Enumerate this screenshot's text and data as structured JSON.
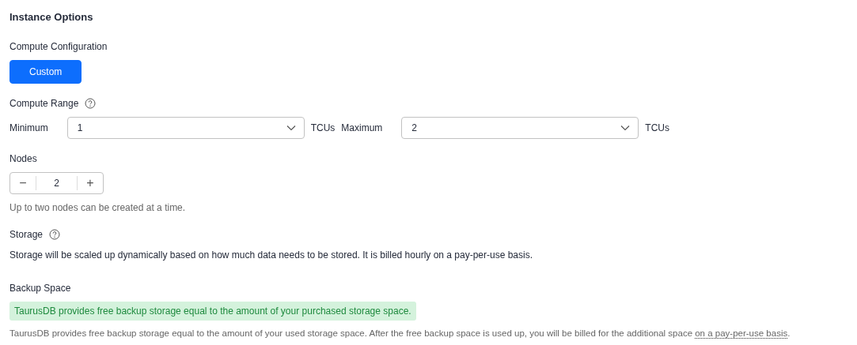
{
  "section_title": "Instance Options",
  "compute_configuration": {
    "label": "Compute Configuration",
    "options": [
      {
        "label": "Custom",
        "selected": true
      }
    ]
  },
  "compute_range": {
    "label": "Compute Range",
    "minimum": {
      "label": "Minimum",
      "value": "1",
      "unit": "TCUs"
    },
    "maximum": {
      "label": "Maximum",
      "value": "2",
      "unit": "TCUs"
    }
  },
  "nodes": {
    "label": "Nodes",
    "decrement": "−",
    "value": "2",
    "increment": "+",
    "hint": "Up to two nodes can be created at a time."
  },
  "storage": {
    "label": "Storage",
    "description": "Storage will be scaled up dynamically based on how much data needs to be stored. It is billed hourly on a pay-per-use basis."
  },
  "backup_space": {
    "label": "Backup Space",
    "notice": "TaurusDB provides free backup storage equal to the amount of your purchased storage space.",
    "description": "TaurusDB provides free backup storage equal to the amount of your used storage space. After the free backup space is used up, you will be billed for the additional space ",
    "link": "on a pay-per-use basis",
    "description_end": "."
  }
}
